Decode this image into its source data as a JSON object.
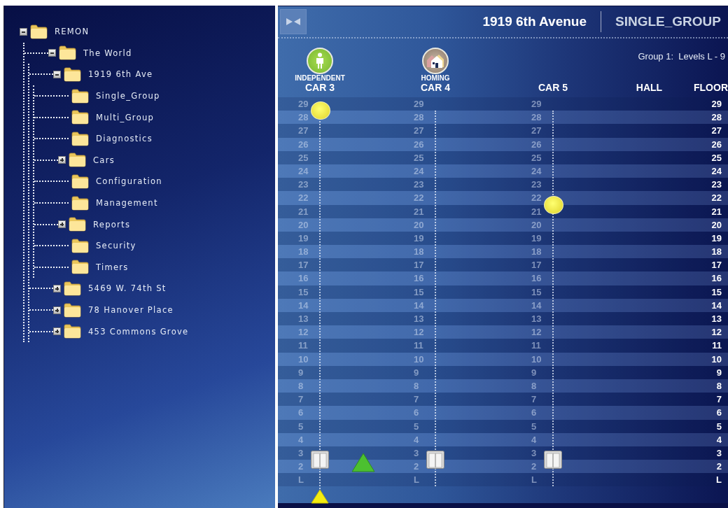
{
  "tree": [
    {
      "label": "REMON",
      "expanded": true,
      "children": [
        {
          "label": "The World",
          "expanded": true,
          "children": [
            {
              "label": "1919 6th Ave",
              "expanded": true,
              "children": [
                {
                  "label": "Single_Group"
                },
                {
                  "label": "Multi_Group"
                },
                {
                  "label": "Diagnostics"
                },
                {
                  "label": "Cars",
                  "expanded": false
                },
                {
                  "label": "Configuration"
                },
                {
                  "label": "Management"
                },
                {
                  "label": "Reports",
                  "expanded": false
                },
                {
                  "label": "Security"
                },
                {
                  "label": "Timers"
                }
              ]
            },
            {
              "label": "5469 W. 74th St",
              "expanded": false
            },
            {
              "label": "78 Hanover Place",
              "expanded": false
            },
            {
              "label": "453 Commons Grove",
              "expanded": false
            }
          ]
        }
      ]
    }
  ],
  "header": {
    "building": "1919 6th Avenue",
    "group": "SINGLE_GROUP",
    "levels": "Group 1:  Levels L - 9"
  },
  "cars": [
    {
      "name": "CAR 3",
      "mode": {
        "kind": "independent",
        "label": "INDEPENDENT"
      },
      "moving_up": true,
      "below_marker": true,
      "floors": [
        {
          "label": "29",
          "car": false,
          "call": false
        },
        {
          "label": "28",
          "car": false,
          "call": true
        },
        {
          "label": "27",
          "car": false,
          "call": false
        },
        {
          "label": "26",
          "car": false,
          "call": false
        },
        {
          "label": "25",
          "car": false,
          "call": false
        },
        {
          "label": "24",
          "car": false,
          "call": false
        },
        {
          "label": "23",
          "car": false,
          "call": false
        },
        {
          "label": "22",
          "car": false,
          "call": false
        },
        {
          "label": "21",
          "car": false,
          "call": false
        },
        {
          "label": "20",
          "car": false,
          "call": false
        },
        {
          "label": "19",
          "car": false,
          "call": false
        },
        {
          "label": "18",
          "car": false,
          "call": false
        },
        {
          "label": "17",
          "car": false,
          "call": false
        },
        {
          "label": "16",
          "car": false,
          "call": false
        },
        {
          "label": "15",
          "car": false,
          "call": false
        },
        {
          "label": "14",
          "car": false,
          "call": false
        },
        {
          "label": "13",
          "car": false,
          "call": false
        },
        {
          "label": "12",
          "car": false,
          "call": false
        },
        {
          "label": "11",
          "car": false,
          "call": false
        },
        {
          "label": "10",
          "car": false,
          "call": false
        },
        {
          "label": "9",
          "car": false,
          "call": false
        },
        {
          "label": "8",
          "car": false,
          "call": false
        },
        {
          "label": "7",
          "car": false,
          "call": false
        },
        {
          "label": "6",
          "car": false,
          "call": false
        },
        {
          "label": "5",
          "car": false,
          "call": false
        },
        {
          "label": "4",
          "car": false,
          "call": false
        },
        {
          "label": "3",
          "car": false,
          "call": false
        },
        {
          "label": "2",
          "car": true,
          "call": false
        },
        {
          "label": "L",
          "car": false,
          "call": false
        }
      ]
    },
    {
      "name": "CAR 4",
      "mode": {
        "kind": "homing",
        "label": "HOMING"
      },
      "moving_up": false,
      "below_marker": false,
      "floors": [
        {
          "label": "29",
          "car": false,
          "call": false
        },
        {
          "label": "28",
          "car": false,
          "call": false
        },
        {
          "label": "27",
          "car": false,
          "call": false
        },
        {
          "label": "26",
          "car": false,
          "call": false
        },
        {
          "label": "25",
          "car": false,
          "call": false
        },
        {
          "label": "24",
          "car": false,
          "call": false
        },
        {
          "label": "23",
          "car": false,
          "call": false
        },
        {
          "label": "22",
          "car": false,
          "call": false
        },
        {
          "label": "21",
          "car": false,
          "call": false
        },
        {
          "label": "20",
          "car": false,
          "call": false
        },
        {
          "label": "19",
          "car": false,
          "call": false
        },
        {
          "label": "18",
          "car": false,
          "call": false
        },
        {
          "label": "17",
          "car": false,
          "call": false
        },
        {
          "label": "16",
          "car": false,
          "call": false
        },
        {
          "label": "15",
          "car": false,
          "call": false
        },
        {
          "label": "14",
          "car": false,
          "call": false
        },
        {
          "label": "13",
          "car": false,
          "call": false
        },
        {
          "label": "12",
          "car": false,
          "call": false
        },
        {
          "label": "11",
          "car": false,
          "call": false
        },
        {
          "label": "10",
          "car": false,
          "call": false
        },
        {
          "label": "9",
          "car": false,
          "call": false
        },
        {
          "label": "8",
          "car": false,
          "call": false
        },
        {
          "label": "7",
          "car": false,
          "call": false
        },
        {
          "label": "6",
          "car": false,
          "call": false
        },
        {
          "label": "5",
          "car": false,
          "call": false
        },
        {
          "label": "4",
          "car": false,
          "call": false
        },
        {
          "label": "3",
          "car": false,
          "call": false
        },
        {
          "label": "2",
          "car": true,
          "call": false
        },
        {
          "label": "L",
          "car": false,
          "call": false
        }
      ]
    },
    {
      "name": "CAR 5",
      "moving_up": false,
      "below_marker": false,
      "floors": [
        {
          "label": "29",
          "car": false,
          "call": false
        },
        {
          "label": "28",
          "car": false,
          "call": false
        },
        {
          "label": "27",
          "car": false,
          "call": false
        },
        {
          "label": "26",
          "car": false,
          "call": false
        },
        {
          "label": "25",
          "car": false,
          "call": false
        },
        {
          "label": "24",
          "car": false,
          "call": false
        },
        {
          "label": "23",
          "car": false,
          "call": false
        },
        {
          "label": "22",
          "car": false,
          "call": false
        },
        {
          "label": "21",
          "car": false,
          "call": true
        },
        {
          "label": "20",
          "car": false,
          "call": false
        },
        {
          "label": "19",
          "car": false,
          "call": false
        },
        {
          "label": "18",
          "car": false,
          "call": false
        },
        {
          "label": "17",
          "car": false,
          "call": false
        },
        {
          "label": "16",
          "car": false,
          "call": false
        },
        {
          "label": "15",
          "car": false,
          "call": false
        },
        {
          "label": "14",
          "car": false,
          "call": false
        },
        {
          "label": "13",
          "car": false,
          "call": false
        },
        {
          "label": "12",
          "car": false,
          "call": false
        },
        {
          "label": "11",
          "car": false,
          "call": false
        },
        {
          "label": "10",
          "car": false,
          "call": false
        },
        {
          "label": "9",
          "car": false,
          "call": false
        },
        {
          "label": "8",
          "car": false,
          "call": false
        },
        {
          "label": "7",
          "car": false,
          "call": false
        },
        {
          "label": "6",
          "car": false,
          "call": false
        },
        {
          "label": "5",
          "car": false,
          "call": false
        },
        {
          "label": "4",
          "car": false,
          "call": false
        },
        {
          "label": "3",
          "car": false,
          "call": false
        },
        {
          "label": "2",
          "car": true,
          "call": false
        },
        {
          "label": "L",
          "car": false,
          "call": false
        }
      ]
    }
  ],
  "hall": {
    "label": "HALL"
  },
  "floor_column": {
    "label": "FLOOR",
    "floors": [
      "29",
      "28",
      "27",
      "26",
      "25",
      "24",
      "23",
      "22",
      "21",
      "20",
      "19",
      "18",
      "17",
      "16",
      "15",
      "14",
      "13",
      "12",
      "11",
      "10",
      "9",
      "8",
      "7",
      "6",
      "5",
      "4",
      "3",
      "2",
      "L"
    ]
  }
}
